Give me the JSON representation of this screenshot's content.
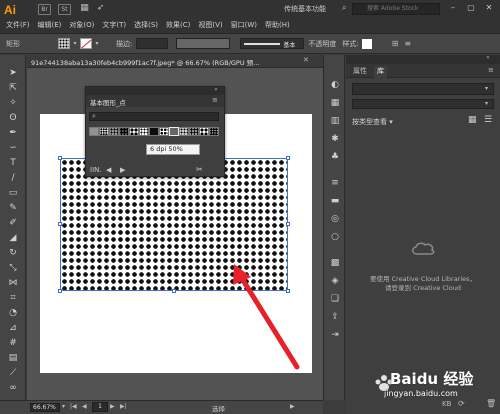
{
  "app": {
    "logo": "Ai",
    "workspace": "传统基本功能",
    "search_placeholder": "搜索 Adobe Stock"
  },
  "titlebar_icons": [
    "Br",
    "St"
  ],
  "menu": [
    "文件(F)",
    "编辑(E)",
    "对象(O)",
    "文字(T)",
    "选择(S)",
    "效果(C)",
    "视图(V)",
    "窗口(W)",
    "帮助(H)"
  ],
  "control_bar": {
    "object_type": "矩形",
    "stroke_label": "描边:",
    "stroke_style": "基本",
    "opacity_label": "不透明度",
    "style_label": "样式:"
  },
  "document": {
    "tab_label": "91e744138aba13a30feb4cb999f1ac7f.jpeg* @ 66.67% (RGB/GPU 预..."
  },
  "swatch_panel": {
    "title": "基本图形_点",
    "tooltip": "6 dpi 50%",
    "footer_label": "IIN."
  },
  "status_bar": {
    "zoom": "66.67%",
    "page": "1",
    "selection": "选择"
  },
  "right_panel": {
    "tabs": [
      "属性",
      "库"
    ],
    "active_tab": "库",
    "sort_label": "按类型查看",
    "empty_message_1": "要使用 Creative Cloud Libraries，",
    "empty_message_2": "请登录到 Creative Cloud",
    "footer_size": "KB"
  },
  "watermark": {
    "brand": "Baidu 经验",
    "url": "jingyan.baidu.com"
  },
  "colors": {
    "accent_orange": "#ff9a00",
    "arrow_red": "#e8202a",
    "selection_blue": "#3a70d0"
  }
}
